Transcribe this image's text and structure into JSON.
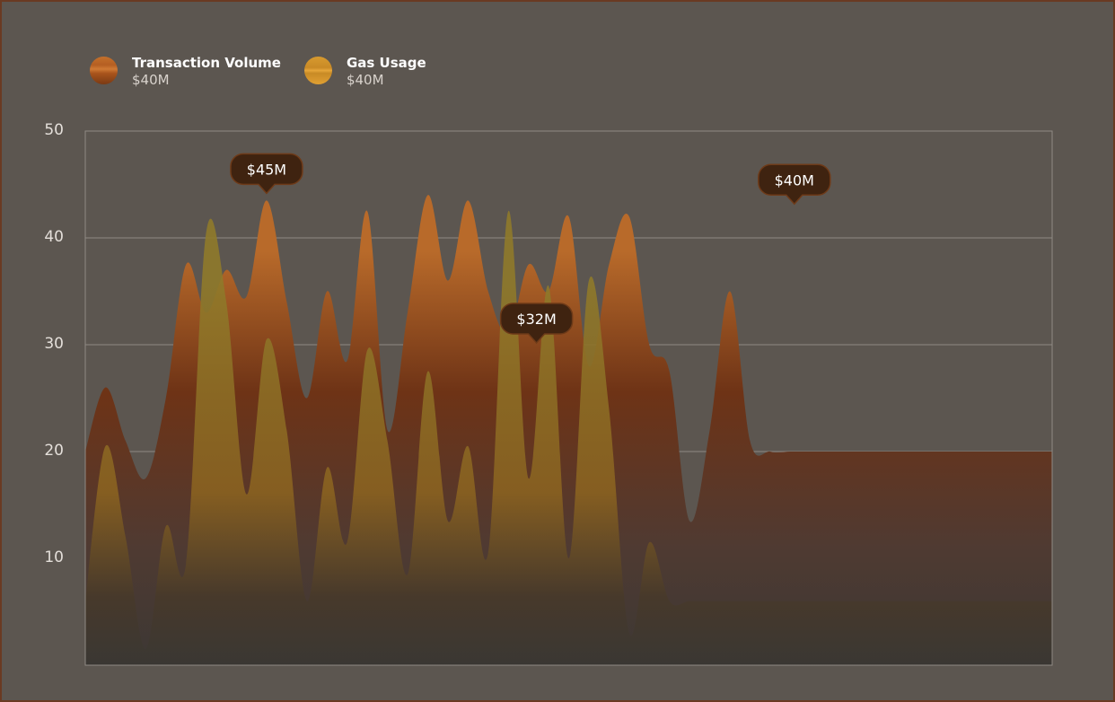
{
  "legend": {
    "items": [
      {
        "name": "Transaction Volume",
        "value": "$40M"
      },
      {
        "name": "Gas Usage",
        "value": "$40M"
      }
    ]
  },
  "colors": {
    "transaction_top": "#b86a2a",
    "transaction_mid": "#6e3316",
    "gas_top": "#8f7a2a",
    "gas_mid": "#8a6220",
    "tooltip_bg": "#3f2310",
    "tooltip_border": "#6e3a18",
    "grid": "#8f8a84"
  },
  "chart_data": {
    "type": "area",
    "title": "",
    "xlabel": "",
    "ylabel": "",
    "ylim": [
      0,
      50
    ],
    "yticks": [
      10,
      20,
      30,
      40,
      50
    ],
    "grid": true,
    "legend_position": "top-left",
    "x": [
      0,
      0.25,
      0.5,
      0.75,
      1,
      1.25,
      1.5,
      1.75,
      2,
      2.25,
      2.5,
      2.75,
      3,
      3.25,
      3.5,
      3.75,
      4,
      4.25,
      4.5,
      4.75,
      5,
      5.25,
      5.5,
      5.75,
      6,
      6.25,
      6.5,
      6.75,
      7,
      7.25,
      7.5,
      7.75,
      8,
      8.25,
      8.5,
      8.75,
      9,
      9.25,
      9.5,
      9.75,
      10,
      10.25,
      10.5,
      10.75,
      11,
      11.25,
      11.5,
      11.75,
      12
    ],
    "series": [
      {
        "name": "Transaction Volume",
        "values": [
          20,
          26,
          21,
          17.5,
          25,
          37.5,
          33,
          37,
          34.5,
          43.5,
          34,
          25,
          35,
          28.5,
          42.5,
          22,
          33,
          44,
          36,
          43.5,
          35,
          31,
          37.5,
          35,
          42,
          28,
          37.5,
          42,
          30,
          27.5,
          13.5,
          22,
          35,
          21,
          20,
          20,
          20,
          20,
          20,
          20,
          20,
          20,
          20,
          20,
          20,
          20,
          20,
          20,
          20
        ]
      },
      {
        "name": "Gas Usage",
        "values": [
          6,
          20.5,
          12,
          1.5,
          13,
          9.5,
          40.5,
          34,
          16,
          30.5,
          22,
          6,
          18.5,
          11.5,
          29.5,
          21,
          8.5,
          27.5,
          13.5,
          20.5,
          10.5,
          42.5,
          17.5,
          35.5,
          10,
          36,
          24,
          3,
          11.5,
          6,
          6,
          6,
          6,
          6,
          6,
          6,
          6,
          6,
          6,
          6,
          6,
          6,
          6,
          6,
          6,
          6,
          6,
          6,
          6
        ]
      }
    ],
    "annotations": [
      {
        "label": "$45M",
        "x": 2.25,
        "y": 43.5
      },
      {
        "label": "$32M",
        "x": 5.6,
        "y": 29.5
      },
      {
        "label": "$40M",
        "x": 8.8,
        "y": 42.5
      }
    ]
  }
}
